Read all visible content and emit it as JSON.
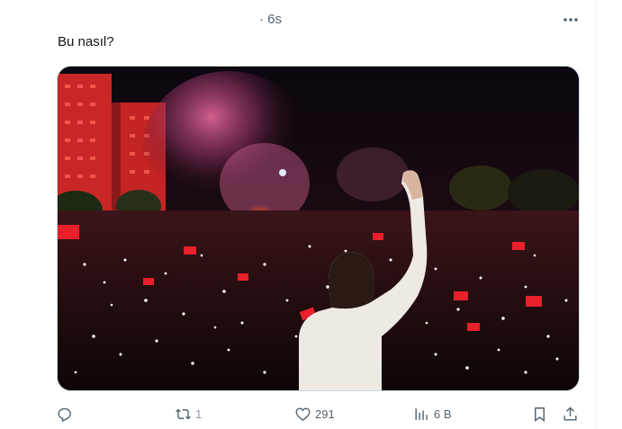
{
  "tweet": {
    "time": "· 6s",
    "text": "Bu nasıl?",
    "media_icon": "photo"
  },
  "actions": {
    "reply_icon": "reply-icon",
    "retweet_icon": "retweet-icon",
    "retweet_count": "1",
    "like_icon": "heart-icon",
    "like_count": "291",
    "views_icon": "views-bar-icon",
    "views_count": "6 B",
    "bookmark_icon": "bookmark-icon",
    "share_icon": "share-icon"
  },
  "colors": {
    "text_primary": "#0f1419",
    "text_secondary": "#536471",
    "border": "#cfd9de"
  }
}
